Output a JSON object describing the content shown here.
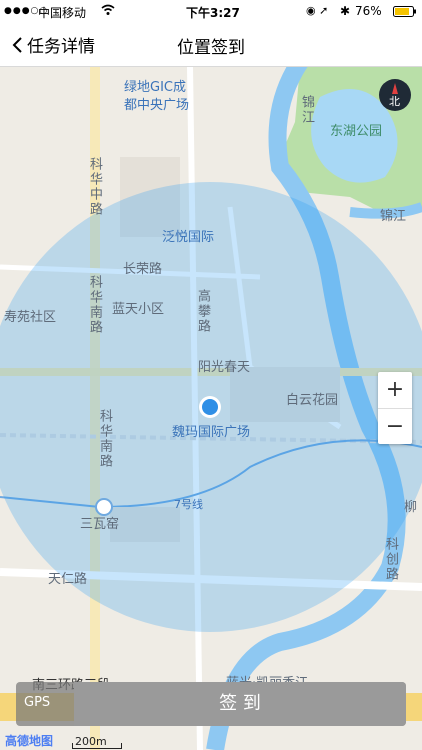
{
  "status_bar": {
    "carrier": "中国移动",
    "time": "下午3:27",
    "battery": "76%"
  },
  "nav": {
    "back_label": "任务详情",
    "title": "位置签到"
  },
  "map": {
    "labels": {
      "green_gic": "绿地GIC成",
      "green_gic2": "都中央广场",
      "donghu_park": "东湖公园",
      "jinjiang1": "锦江",
      "jinjiang2": "锦江",
      "fanyue": "泛悦国际",
      "changrong_road": "长荣路",
      "shouyuan": "寿苑社区",
      "lantian": "蓝天小区",
      "gaopan_road": "高攀路",
      "yangguang": "阳光春天",
      "baiyun": "白云花园",
      "weima": "魏玛国际广场",
      "kehua_middle": "科华中路",
      "kehua_south1": "科华南路",
      "kehua_south2": "科华南路",
      "sanwayao": "三瓦窑",
      "line7": "7号线",
      "tianren_road": "天仁路",
      "kechuang_road": "科创路",
      "liu": "柳",
      "third_ring": "南三环路三段",
      "blue_light": "蓝光·凯丽香江"
    },
    "compass": "北",
    "zoom_in": "+",
    "zoom_out": "−",
    "scale_label": "200m",
    "provider": "高德地图"
  },
  "bottom": {
    "gps_label": "GPS",
    "checkin_label": "签 到"
  },
  "colors": {
    "radius_fill": "#2196f3",
    "location_dot": "#2f8fe6",
    "river": "#8ec8f2",
    "park": "#b9dfa8",
    "water": "#a8d8f5"
  }
}
